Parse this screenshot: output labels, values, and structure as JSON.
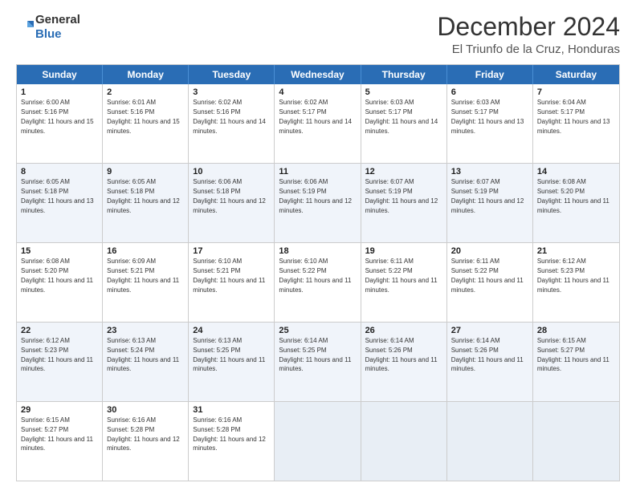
{
  "header": {
    "logo": {
      "line1": "General",
      "line2": "Blue"
    },
    "title": "December 2024",
    "subtitle": "El Triunfo de la Cruz, Honduras"
  },
  "calendar": {
    "days": [
      "Sunday",
      "Monday",
      "Tuesday",
      "Wednesday",
      "Thursday",
      "Friday",
      "Saturday"
    ],
    "weeks": [
      [
        {
          "day": "1",
          "sunrise": "6:00 AM",
          "sunset": "5:16 PM",
          "daylight": "11 hours and 15 minutes."
        },
        {
          "day": "2",
          "sunrise": "6:01 AM",
          "sunset": "5:16 PM",
          "daylight": "11 hours and 15 minutes."
        },
        {
          "day": "3",
          "sunrise": "6:02 AM",
          "sunset": "5:16 PM",
          "daylight": "11 hours and 14 minutes."
        },
        {
          "day": "4",
          "sunrise": "6:02 AM",
          "sunset": "5:17 PM",
          "daylight": "11 hours and 14 minutes."
        },
        {
          "day": "5",
          "sunrise": "6:03 AM",
          "sunset": "5:17 PM",
          "daylight": "11 hours and 14 minutes."
        },
        {
          "day": "6",
          "sunrise": "6:03 AM",
          "sunset": "5:17 PM",
          "daylight": "11 hours and 13 minutes."
        },
        {
          "day": "7",
          "sunrise": "6:04 AM",
          "sunset": "5:17 PM",
          "daylight": "11 hours and 13 minutes."
        }
      ],
      [
        {
          "day": "8",
          "sunrise": "6:05 AM",
          "sunset": "5:18 PM",
          "daylight": "11 hours and 13 minutes."
        },
        {
          "day": "9",
          "sunrise": "6:05 AM",
          "sunset": "5:18 PM",
          "daylight": "11 hours and 12 minutes."
        },
        {
          "day": "10",
          "sunrise": "6:06 AM",
          "sunset": "5:18 PM",
          "daylight": "11 hours and 12 minutes."
        },
        {
          "day": "11",
          "sunrise": "6:06 AM",
          "sunset": "5:19 PM",
          "daylight": "11 hours and 12 minutes."
        },
        {
          "day": "12",
          "sunrise": "6:07 AM",
          "sunset": "5:19 PM",
          "daylight": "11 hours and 12 minutes."
        },
        {
          "day": "13",
          "sunrise": "6:07 AM",
          "sunset": "5:19 PM",
          "daylight": "11 hours and 12 minutes."
        },
        {
          "day": "14",
          "sunrise": "6:08 AM",
          "sunset": "5:20 PM",
          "daylight": "11 hours and 11 minutes."
        }
      ],
      [
        {
          "day": "15",
          "sunrise": "6:08 AM",
          "sunset": "5:20 PM",
          "daylight": "11 hours and 11 minutes."
        },
        {
          "day": "16",
          "sunrise": "6:09 AM",
          "sunset": "5:21 PM",
          "daylight": "11 hours and 11 minutes."
        },
        {
          "day": "17",
          "sunrise": "6:10 AM",
          "sunset": "5:21 PM",
          "daylight": "11 hours and 11 minutes."
        },
        {
          "day": "18",
          "sunrise": "6:10 AM",
          "sunset": "5:22 PM",
          "daylight": "11 hours and 11 minutes."
        },
        {
          "day": "19",
          "sunrise": "6:11 AM",
          "sunset": "5:22 PM",
          "daylight": "11 hours and 11 minutes."
        },
        {
          "day": "20",
          "sunrise": "6:11 AM",
          "sunset": "5:22 PM",
          "daylight": "11 hours and 11 minutes."
        },
        {
          "day": "21",
          "sunrise": "6:12 AM",
          "sunset": "5:23 PM",
          "daylight": "11 hours and 11 minutes."
        }
      ],
      [
        {
          "day": "22",
          "sunrise": "6:12 AM",
          "sunset": "5:23 PM",
          "daylight": "11 hours and 11 minutes."
        },
        {
          "day": "23",
          "sunrise": "6:13 AM",
          "sunset": "5:24 PM",
          "daylight": "11 hours and 11 minutes."
        },
        {
          "day": "24",
          "sunrise": "6:13 AM",
          "sunset": "5:25 PM",
          "daylight": "11 hours and 11 minutes."
        },
        {
          "day": "25",
          "sunrise": "6:14 AM",
          "sunset": "5:25 PM",
          "daylight": "11 hours and 11 minutes."
        },
        {
          "day": "26",
          "sunrise": "6:14 AM",
          "sunset": "5:26 PM",
          "daylight": "11 hours and 11 minutes."
        },
        {
          "day": "27",
          "sunrise": "6:14 AM",
          "sunset": "5:26 PM",
          "daylight": "11 hours and 11 minutes."
        },
        {
          "day": "28",
          "sunrise": "6:15 AM",
          "sunset": "5:27 PM",
          "daylight": "11 hours and 11 minutes."
        }
      ],
      [
        {
          "day": "29",
          "sunrise": "6:15 AM",
          "sunset": "5:27 PM",
          "daylight": "11 hours and 11 minutes."
        },
        {
          "day": "30",
          "sunrise": "6:16 AM",
          "sunset": "5:28 PM",
          "daylight": "11 hours and 12 minutes."
        },
        {
          "day": "31",
          "sunrise": "6:16 AM",
          "sunset": "5:28 PM",
          "daylight": "11 hours and 12 minutes."
        },
        null,
        null,
        null,
        null
      ]
    ]
  }
}
